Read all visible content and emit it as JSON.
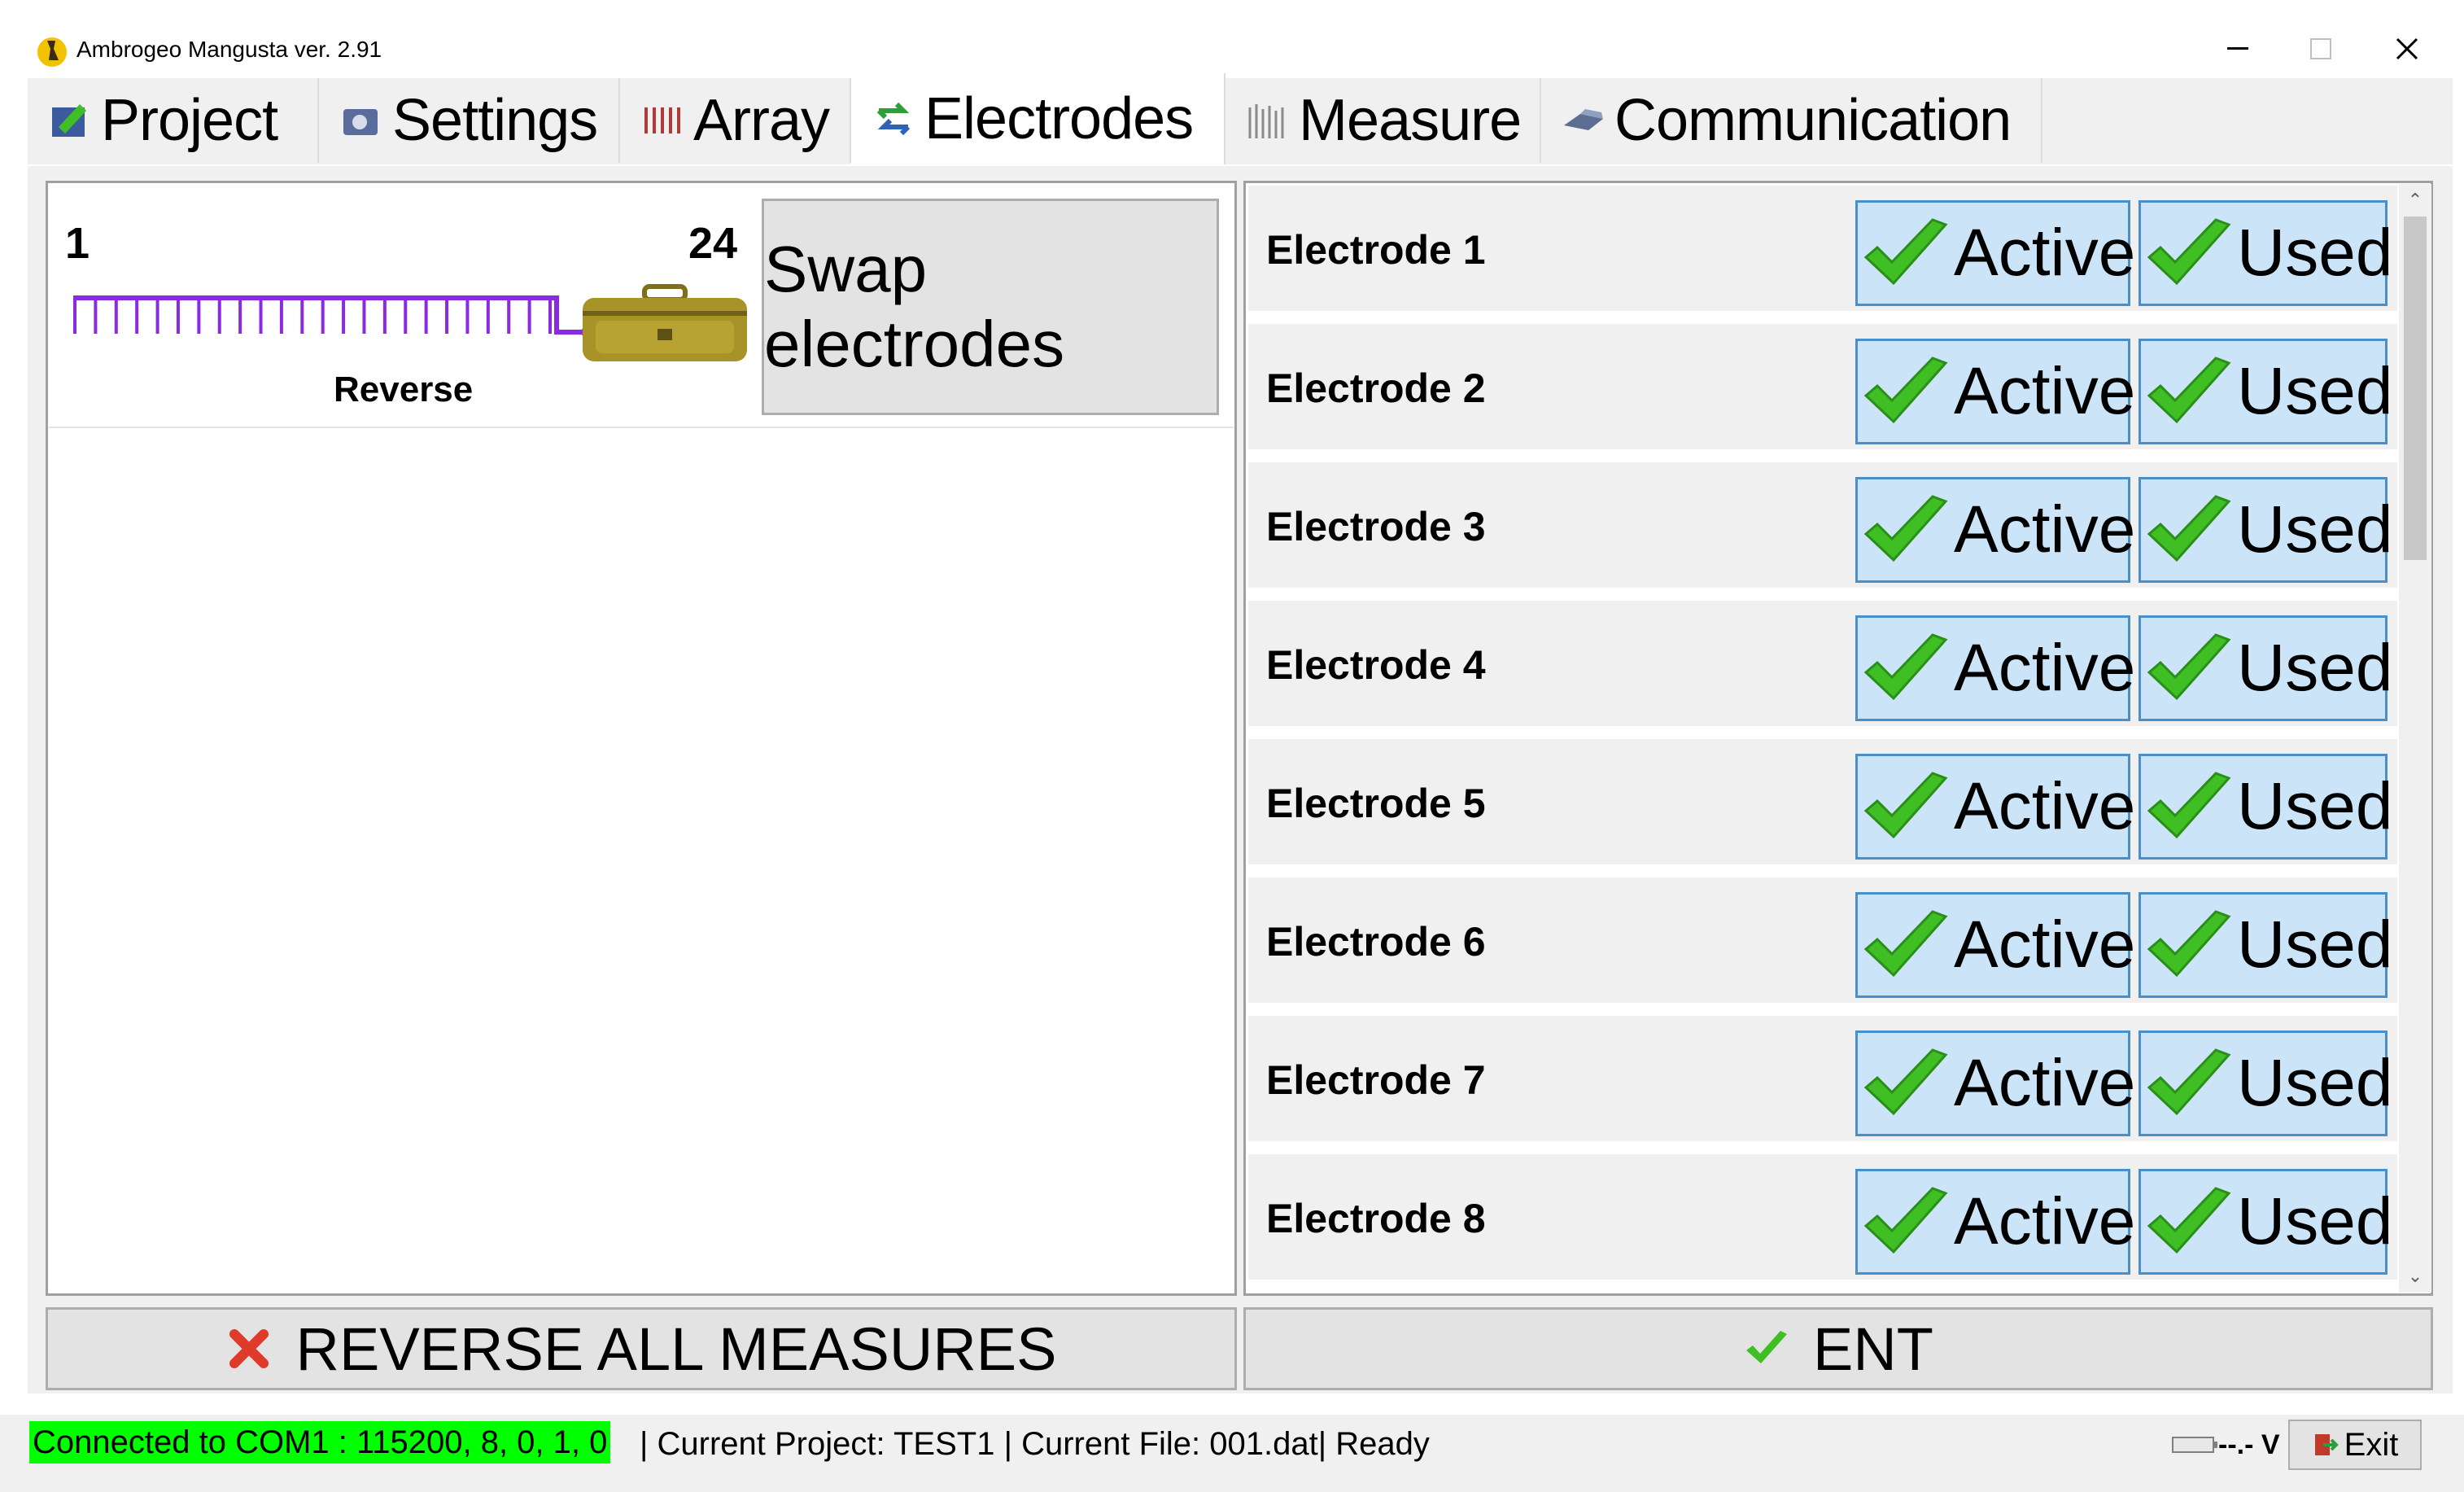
{
  "window": {
    "title": "Ambrogeo Mangusta ver. 2.91"
  },
  "tabs": [
    {
      "label": "Project",
      "icon": "project-icon"
    },
    {
      "label": "Settings",
      "icon": "settings-icon"
    },
    {
      "label": "Array",
      "icon": "array-icon"
    },
    {
      "label": "Electrodes",
      "icon": "electrodes-icon",
      "active": true
    },
    {
      "label": "Measure",
      "icon": "measure-icon"
    },
    {
      "label": "Communication",
      "icon": "communication-icon"
    }
  ],
  "reverse_panel": {
    "first_electrode": "1",
    "last_electrode": "24",
    "mode_label": "Reverse",
    "swap_button": "Swap electrodes"
  },
  "electrodes": [
    {
      "name": "Electrode 1",
      "active_label": "Active",
      "used_label": "Used"
    },
    {
      "name": "Electrode 2",
      "active_label": "Active",
      "used_label": "Used"
    },
    {
      "name": "Electrode 3",
      "active_label": "Active",
      "used_label": "Used"
    },
    {
      "name": "Electrode 4",
      "active_label": "Active",
      "used_label": "Used"
    },
    {
      "name": "Electrode 5",
      "active_label": "Active",
      "used_label": "Used"
    },
    {
      "name": "Electrode 6",
      "active_label": "Active",
      "used_label": "Used"
    },
    {
      "name": "Electrode 7",
      "active_label": "Active",
      "used_label": "Used"
    },
    {
      "name": "Electrode 8",
      "active_label": "Active",
      "used_label": "Used"
    }
  ],
  "bottom_buttons": {
    "reverse_all": "REVERSE ALL MEASURES",
    "ent": "ENT"
  },
  "status_bar": {
    "connection": "Connected to COM1 : 115200, 8, 0, 1, 0",
    "info": "| Current Project: TEST1 | Current File: 001.dat| Ready",
    "battery": "--.- V",
    "exit_label": "Exit"
  },
  "colors": {
    "accent_blue": "#cce4f7",
    "accent_border": "#4a8fc8",
    "check_green": "#3fbf24",
    "array_purple": "#8a2be2",
    "connection_bg": "#00ff00",
    "cancel_red": "#e03a2a"
  }
}
